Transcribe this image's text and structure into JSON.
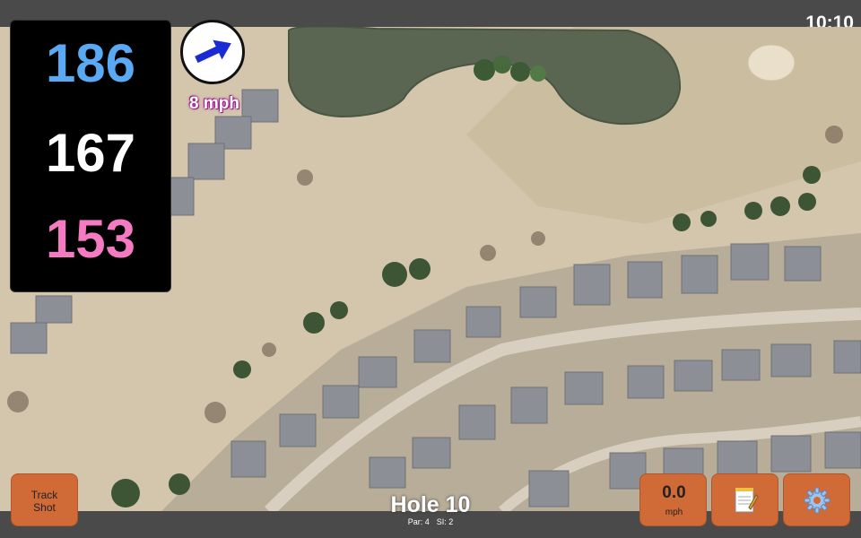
{
  "status": {
    "time": "10:10"
  },
  "yardage": {
    "back": "186",
    "middle": "167",
    "front": "153"
  },
  "wind": {
    "speed": "8 mph",
    "direction_icon": "arrow-icon"
  },
  "hole": {
    "title": "Hole 10",
    "par": "Par: 4",
    "si": "SI: 2"
  },
  "buttons": {
    "track_shot_line1": "Track",
    "track_shot_line2": "Shot",
    "speed_value": "0.0",
    "speed_unit": "mph",
    "notes_icon": "notepad-icon",
    "settings_icon": "gear-icon"
  },
  "colors": {
    "back": "#5aa9f5",
    "middle": "#ffffff",
    "front": "#f47bc2",
    "button": "#d06a36",
    "wind_arrow": "#1a2bd6"
  }
}
